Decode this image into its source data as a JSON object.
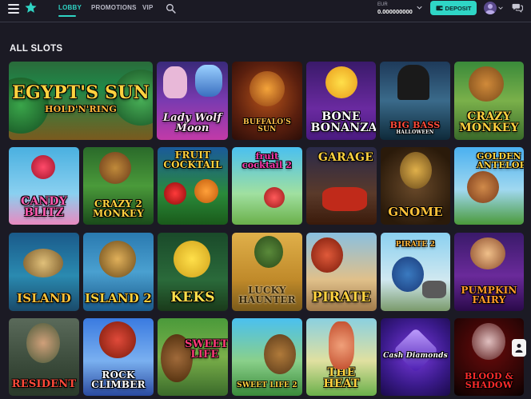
{
  "header": {
    "tabs": [
      {
        "label": "LOBBY",
        "active": true
      },
      {
        "label": "PROMOTIONS",
        "active": false
      },
      {
        "label": "VIP",
        "active": false
      }
    ],
    "balance": {
      "currency": "EUR",
      "amount": "0.000000000"
    },
    "deposit_label": "DEPOSIT",
    "icons": [
      "menu-icon",
      "star-icon",
      "search-icon",
      "wallet-icon",
      "avatar",
      "chat-icon"
    ]
  },
  "section": {
    "title": "ALL SLOTS"
  },
  "colors": {
    "accent": "#2fd4c4",
    "background": "#1b1a24"
  },
  "games": [
    {
      "title": "EGYPT'S SUN",
      "subtitle": "HOLD'N'RING"
    },
    {
      "title": "Lady Wolf Moon"
    },
    {
      "title": "BUFFALO'S SUN"
    },
    {
      "title": "BONE BONANZA"
    },
    {
      "title": "BIG BASS",
      "subtitle": "HALLOWEEN"
    },
    {
      "title": "CRAZY MONKEY"
    },
    {
      "title": "CANDY BLITZ"
    },
    {
      "title": "CRAZY 2 MONKEY"
    },
    {
      "title": "FRUIT COCKTAIL"
    },
    {
      "title": "fruit cocktail 2"
    },
    {
      "title": "GARAGE"
    },
    {
      "title": "GNOME"
    },
    {
      "title": "GOLDEN ANTELOPE"
    },
    {
      "title": "ISLAND"
    },
    {
      "title": "ISLAND 2"
    },
    {
      "title": "KEKS"
    },
    {
      "title": "LUCKY HAUNTER"
    },
    {
      "title": "PIRATE"
    },
    {
      "title": "PIRATE 2"
    },
    {
      "title": "PUMPKIN FAIRY"
    },
    {
      "title": "RESIDENT"
    },
    {
      "title": "ROCK CLIMBER"
    },
    {
      "title": "SWEET LIFE"
    },
    {
      "title": "SWEET LIFE 2"
    },
    {
      "title": "THE HEAT"
    },
    {
      "title": "Cash Diamonds"
    },
    {
      "title": "BLOOD & SHADOW"
    }
  ]
}
